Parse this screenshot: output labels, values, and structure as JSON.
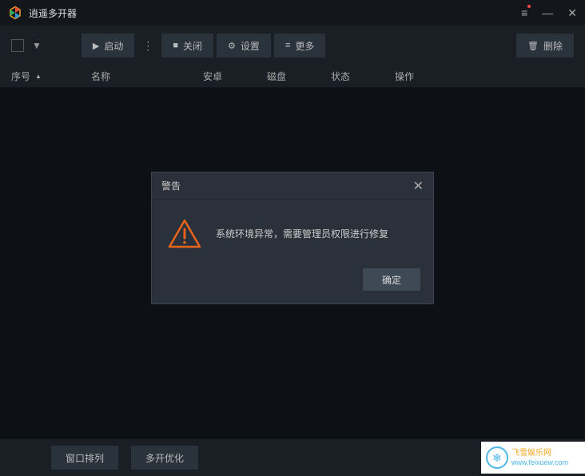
{
  "titlebar": {
    "app_name": "逍遥多开器"
  },
  "toolbar": {
    "start_label": "启动",
    "close_label": "关闭",
    "settings_label": "设置",
    "more_label": "更多",
    "delete_label": "删除"
  },
  "table": {
    "headers": {
      "seq": "序号",
      "name": "名称",
      "android": "安卓",
      "disk": "磁盘",
      "status": "状态",
      "action": "操作"
    }
  },
  "bottombar": {
    "window_arrange": "窗口排列",
    "multi_optimize": "多开优化"
  },
  "modal": {
    "title": "警告",
    "message": "系统环境异常，需要管理员权限进行修复",
    "ok_label": "确定"
  },
  "brand": {
    "name": "飞雪娱乐网",
    "url": "www.feixuew.com"
  }
}
